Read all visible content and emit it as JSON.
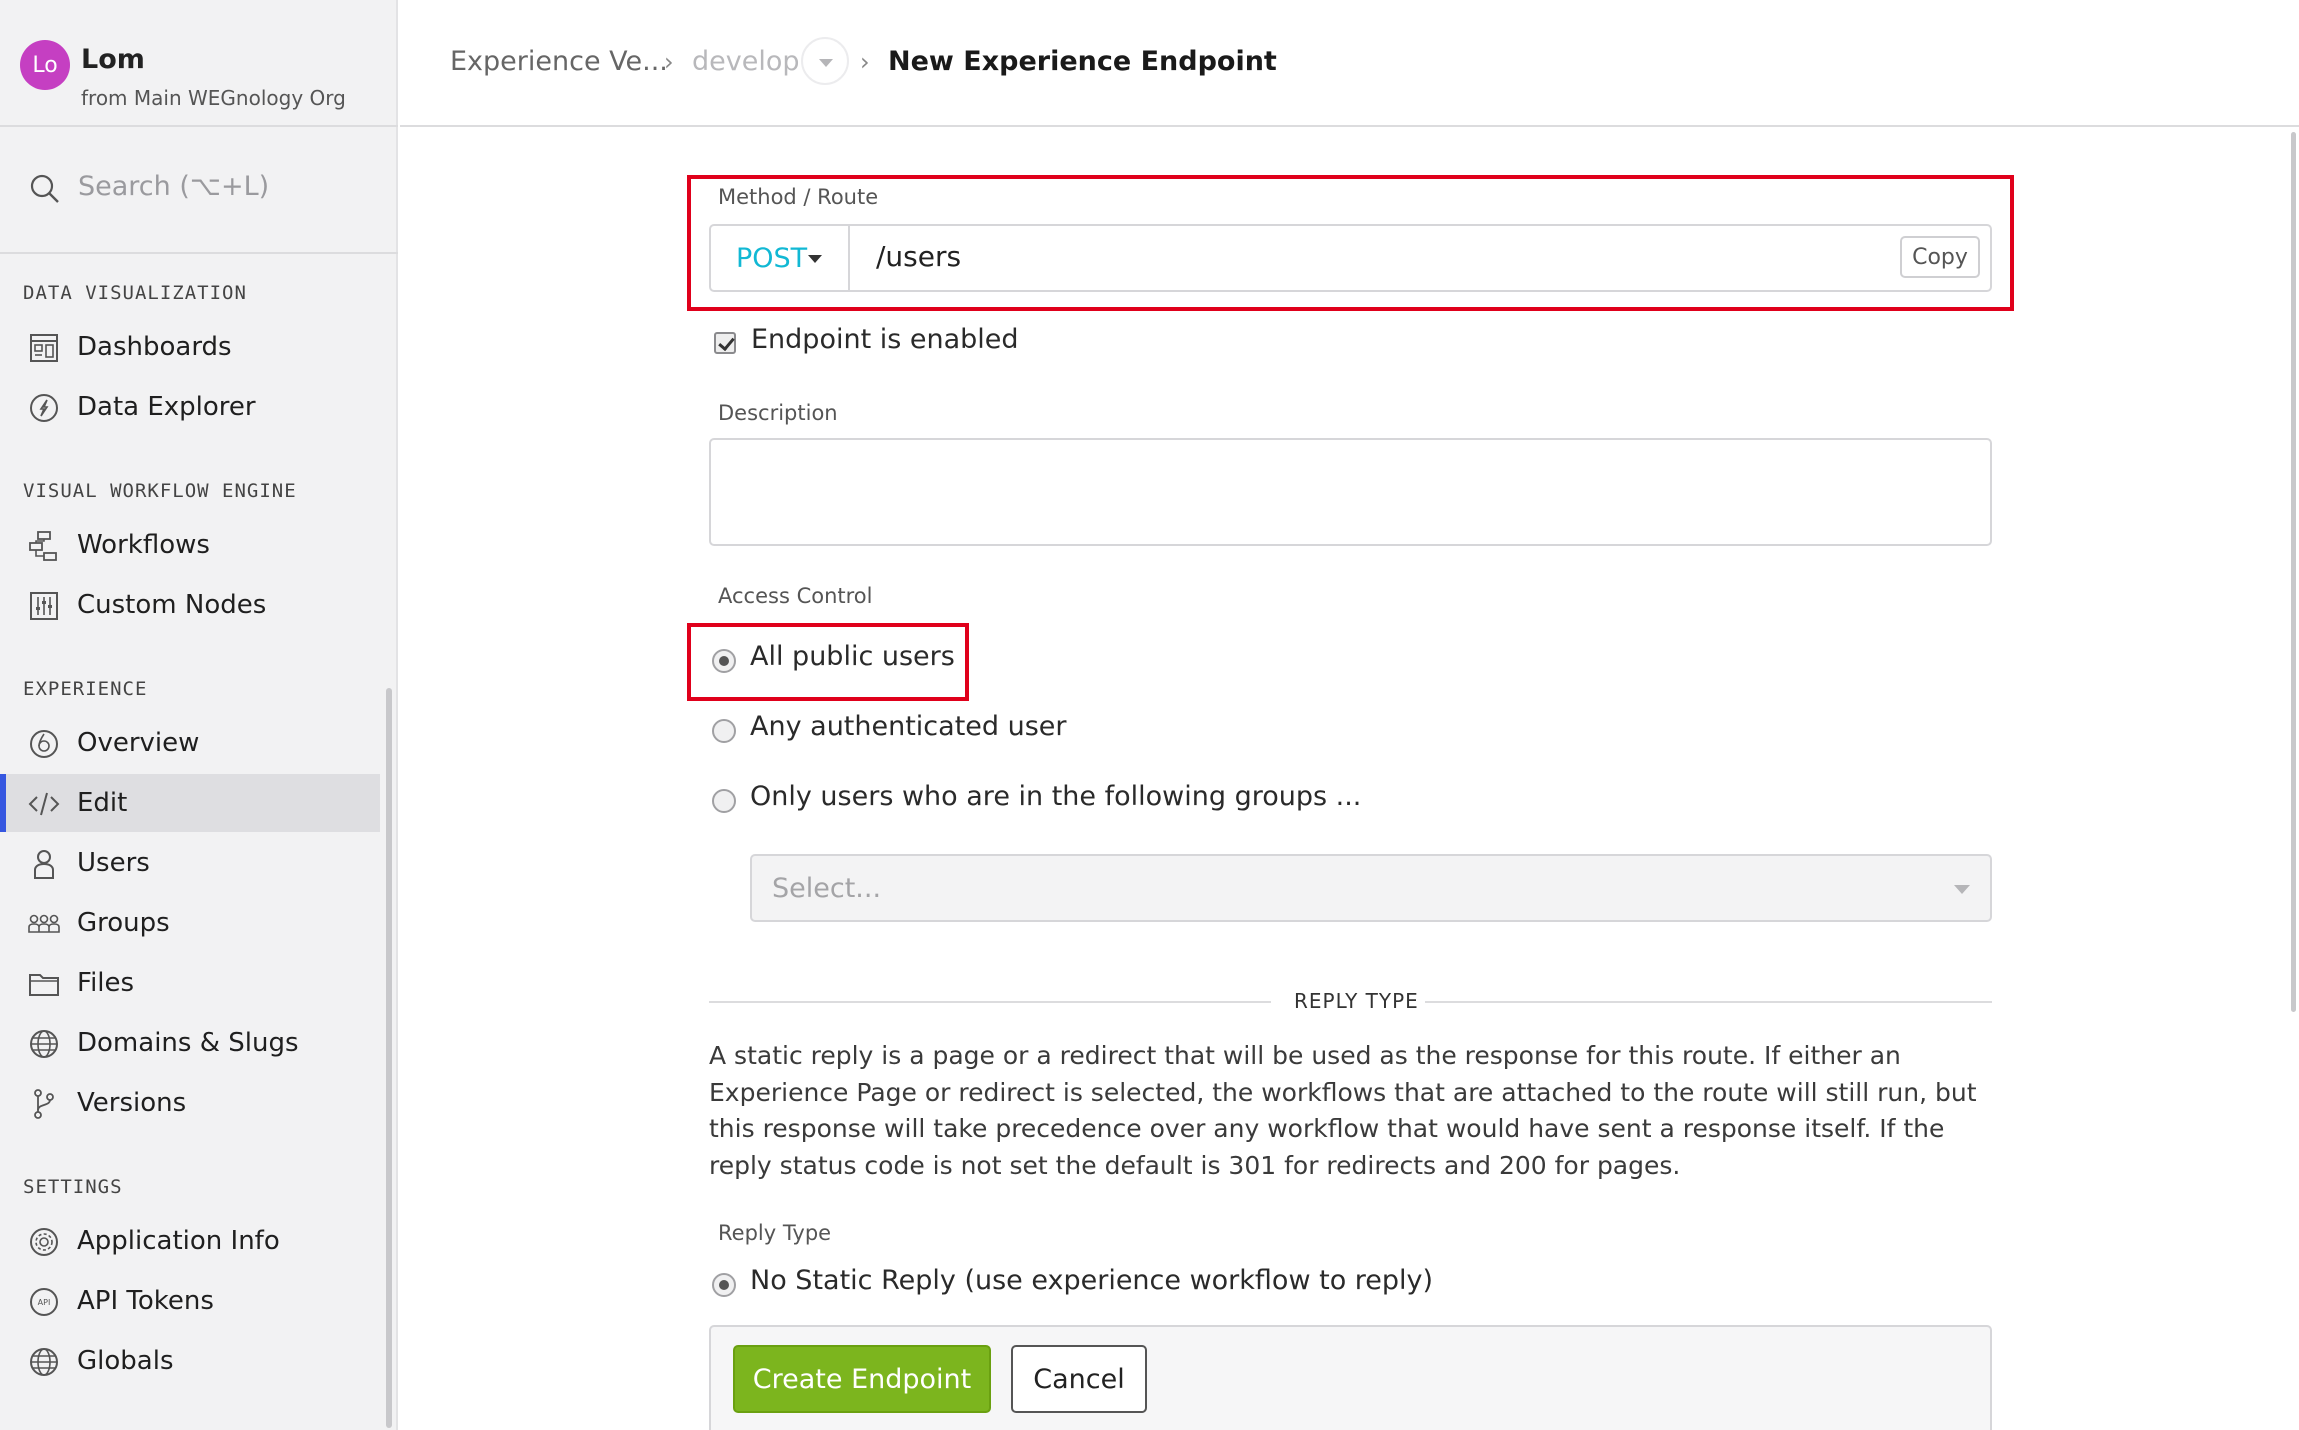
{
  "user": {
    "initials": "Lo",
    "name": "Lom",
    "org": "from Main WEGnology Org"
  },
  "search": {
    "label": "Search (⌥+L)"
  },
  "sidebar": {
    "sections": [
      {
        "title": "DATA VISUALIZATION",
        "items": [
          {
            "label": "Dashboards",
            "icon": "dashboard-icon"
          },
          {
            "label": "Data Explorer",
            "icon": "compass-icon"
          }
        ]
      },
      {
        "title": "VISUAL WORKFLOW ENGINE",
        "items": [
          {
            "label": "Workflows",
            "icon": "workflow-icon"
          },
          {
            "label": "Custom Nodes",
            "icon": "sliders-icon"
          }
        ]
      },
      {
        "title": "EXPERIENCE",
        "items": [
          {
            "label": "Overview",
            "icon": "overview-icon"
          },
          {
            "label": "Edit",
            "icon": "code-icon",
            "active": true
          },
          {
            "label": "Users",
            "icon": "user-icon"
          },
          {
            "label": "Groups",
            "icon": "groups-icon"
          },
          {
            "label": "Files",
            "icon": "folder-icon"
          },
          {
            "label": "Domains & Slugs",
            "icon": "globe-icon"
          },
          {
            "label": "Versions",
            "icon": "branch-icon"
          }
        ]
      },
      {
        "title": "SETTINGS",
        "items": [
          {
            "label": "Application Info",
            "icon": "gear-icon"
          },
          {
            "label": "API Tokens",
            "icon": "api-token-icon"
          },
          {
            "label": "Globals",
            "icon": "globe-icon"
          }
        ]
      }
    ]
  },
  "breadcrumb": {
    "item1": "Experience Ve...",
    "item2": "develop",
    "item3": "New Experience Endpoint",
    "sep": "›"
  },
  "form": {
    "method_route_label": "Method / Route",
    "method": "POST",
    "route": "/users",
    "copy_label": "Copy",
    "enabled_label": "Endpoint is enabled",
    "description_label": "Description",
    "description_value": "",
    "access_label": "Access Control",
    "access_options": [
      "All public users",
      "Any authenticated user",
      "Only users who are in the following groups ..."
    ],
    "groups_placeholder": "Select...",
    "reply_type_heading": "REPLY TYPE",
    "reply_help": "A static reply is a page or a redirect that will be used as the response for this route. If either an Experience Page or redirect is selected, the workflows that are attached to the route will still run, but this response will take precedence over any workflow that would have sent a response itself. If the reply status code is not set the default is 301 for redirects and 200 for pages.",
    "reply_type_label": "Reply Type",
    "reply_option": "No Static Reply (use experience workflow to reply)",
    "create_label": "Create Endpoint",
    "cancel_label": "Cancel"
  },
  "colors": {
    "accent": "#3657e0",
    "method": "#11b8d4",
    "create": "#7cb51e",
    "highlight": "#e0001b",
    "avatar": "#c53fc2"
  }
}
